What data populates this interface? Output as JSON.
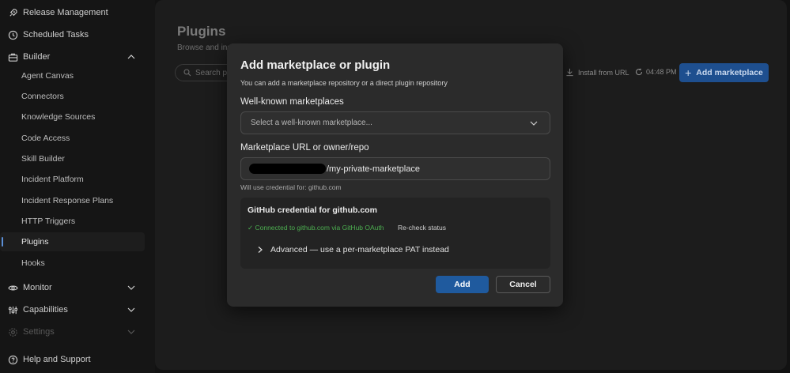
{
  "sidebar": {
    "release_management": "Release Management",
    "scheduled_tasks": "Scheduled Tasks",
    "builder": "Builder",
    "builder_items": [
      "Agent Canvas",
      "Connectors",
      "Knowledge Sources",
      "Code Access",
      "Skill Builder",
      "Incident Platform",
      "Incident Response Plans",
      "HTTP Triggers",
      "Plugins",
      "Hooks"
    ],
    "monitor": "Monitor",
    "capabilities": "Capabilities",
    "settings": "Settings",
    "help": "Help and Support"
  },
  "main": {
    "title": "Plugins",
    "subtitle": "Browse and ins",
    "search_placeholder": "Search p",
    "install_from_url": "Install from URL",
    "time": "04:48 PM",
    "add_marketplace": "Add marketplace"
  },
  "modal": {
    "title": "Add marketplace or plugin",
    "subtitle": "You can add a marketplace repository or a direct plugin repository",
    "well_known_label": "Well-known marketplaces",
    "select_placeholder": "Select a well-known marketplace...",
    "url_label": "Marketplace URL or owner/repo",
    "url_value": "/my-private-marketplace",
    "credential_hint": "Will use credential for: github.com",
    "credential_title": "GitHub credential for github.com",
    "credential_status": "✓ Connected to github.com via GitHub OAuth",
    "recheck": "Re-check status",
    "advanced": "Advanced — use a per-marketplace PAT instead",
    "add_button": "Add",
    "cancel_button": "Cancel"
  },
  "colors": {
    "accent": "#1f5a9e",
    "success": "#4caf50"
  }
}
